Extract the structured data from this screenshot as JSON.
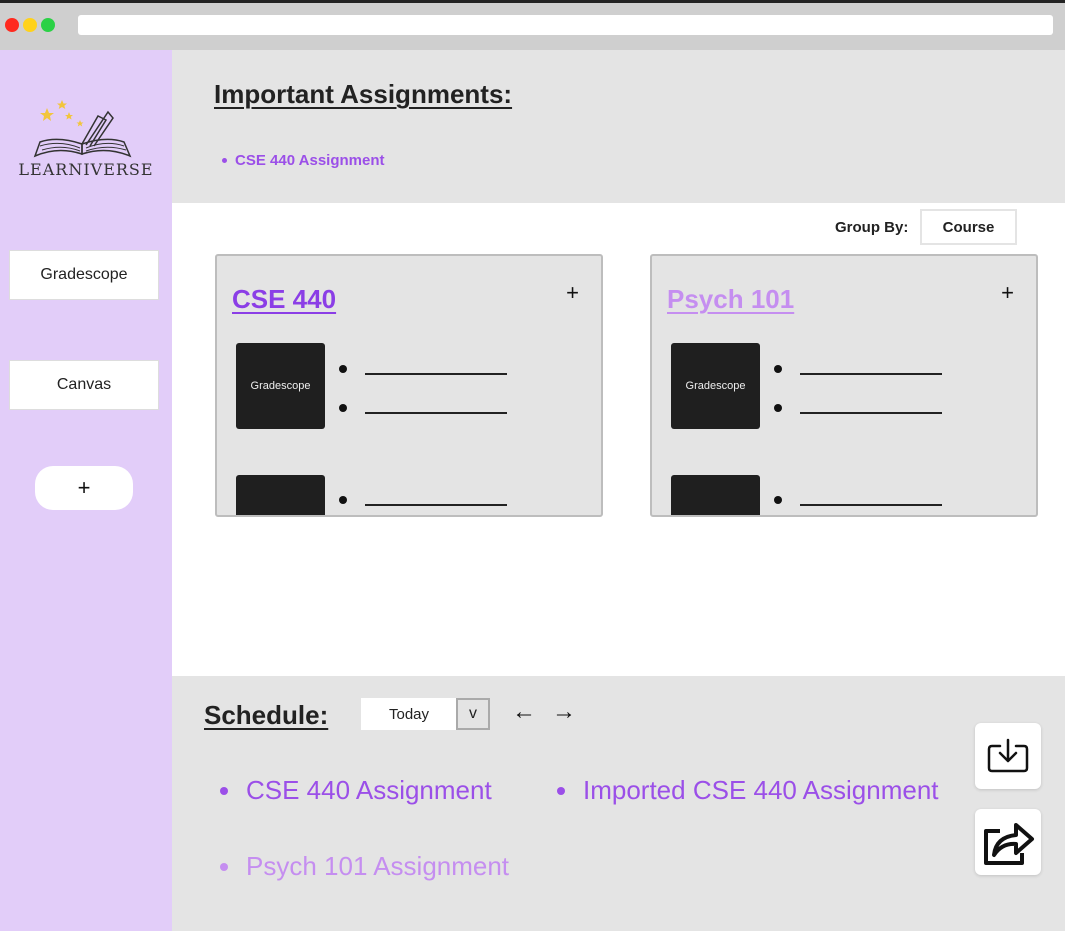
{
  "app": {
    "name": "LEARNIVERSE",
    "accent": "#9b4fe8",
    "accent_light": "#c58ef0",
    "sidebar_bg": "#e2cdf9"
  },
  "sidebar": {
    "items": [
      {
        "label": "Gradescope"
      },
      {
        "label": "Canvas"
      }
    ],
    "add_label": "+"
  },
  "important": {
    "title": "Important Assignments:",
    "items": [
      "CSE 440 Assignment"
    ]
  },
  "group_by": {
    "label": "Group By:",
    "value": "Course"
  },
  "courses": [
    {
      "title": "CSE 440",
      "add_label": "+",
      "block_label": "Gradescope",
      "color": "#8b3ee6"
    },
    {
      "title": "Psych 101",
      "add_label": "+",
      "block_label": "Gradescope",
      "color": "#c58ef0"
    }
  ],
  "schedule": {
    "title": "Schedule:",
    "range_value": "Today",
    "toggle_label": "v",
    "prev_label": "←",
    "next_label": "→",
    "items": [
      {
        "label": "CSE 440 Assignment",
        "color": "#9b4fe8"
      },
      {
        "label": "Imported CSE 440 Assignment",
        "color": "#9b4fe8"
      },
      {
        "label": "Psych 101 Assignment",
        "color": "#c58ef0"
      }
    ]
  },
  "icons": {
    "import": "download-tray-icon",
    "share": "share-arrow-icon"
  }
}
